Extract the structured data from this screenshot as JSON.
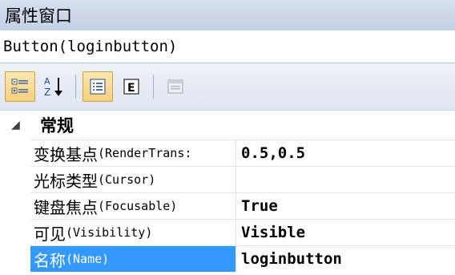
{
  "window": {
    "title": "属性窗口"
  },
  "object": {
    "label": "Button(loginbutton)"
  },
  "toolbar": {
    "buttons": [
      {
        "icon": "categorized-icon",
        "active": true
      },
      {
        "icon": "alphabetical-sort-icon",
        "active": false
      },
      {
        "icon": "properties-icon",
        "active": true
      },
      {
        "icon": "events-icon",
        "active": false
      },
      {
        "icon": "property-pages-icon",
        "active": false,
        "disabled": true
      }
    ]
  },
  "grid": {
    "category": {
      "toggle": "◢",
      "label": "常规"
    },
    "rows": [
      {
        "name_cn": "变换基点",
        "name_en": "(RenderTrans:",
        "value": "0.5,0.5",
        "selected": false
      },
      {
        "name_cn": "光标类型",
        "name_en": "(Cursor)",
        "value": "",
        "selected": false
      },
      {
        "name_cn": "键盘焦点",
        "name_en": "(Focusable)",
        "value": "True",
        "selected": false
      },
      {
        "name_cn": "可见",
        "name_en": "(Visibility)",
        "value": "Visible",
        "selected": false
      },
      {
        "name_cn": "名称",
        "name_en": "(Name)",
        "value": "loginbutton",
        "selected": true
      }
    ]
  },
  "colors": {
    "titlebar": "#c3d1e4",
    "selection": "#3399ff",
    "toolbar_active": "#f5d07c"
  }
}
